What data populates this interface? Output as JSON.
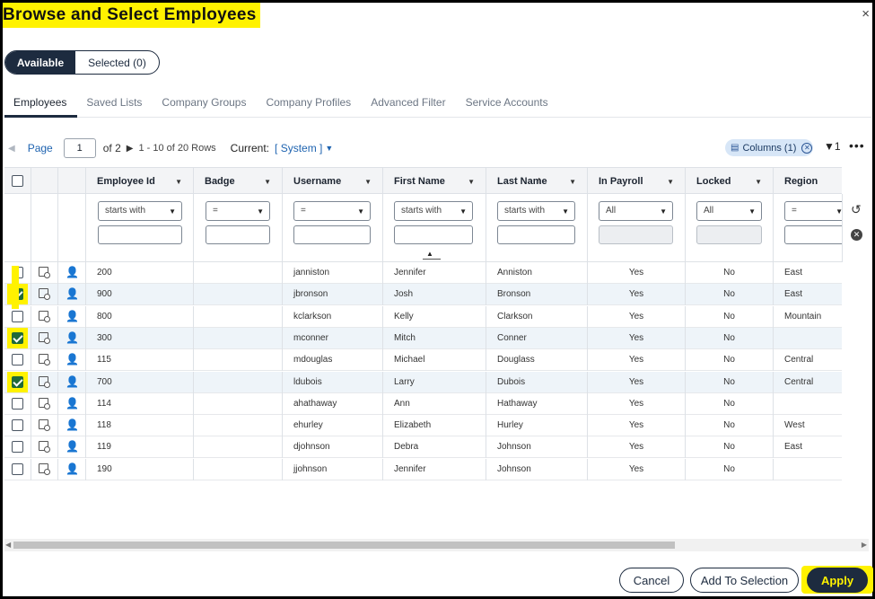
{
  "dialog": {
    "title": "Browse and Select Employees",
    "close_icon": "×"
  },
  "segment": {
    "available": "Available",
    "selected": "Selected (0)"
  },
  "tabs": [
    "Employees",
    "Saved Lists",
    "Company Groups",
    "Company Profiles",
    "Advanced Filter",
    "Service Accounts"
  ],
  "pager": {
    "page_label": "Page",
    "page_value": "1",
    "of_text": "of 2",
    "rows_text": "1 - 10 of 20 Rows",
    "current_label": "Current:",
    "current_value": "[ System ]"
  },
  "toolbar": {
    "columns_label": "Columns (1)",
    "filter_count": "1"
  },
  "columns": [
    "Employee Id",
    "Badge",
    "Username",
    "First Name",
    "Last Name",
    "In Payroll",
    "Locked",
    "Region"
  ],
  "filters": {
    "employee_id": "starts with",
    "badge": "=",
    "username": "=",
    "first_name": "starts with",
    "last_name": "starts with",
    "in_payroll": "All",
    "locked": "All",
    "region": "="
  },
  "rows": [
    {
      "checked": false,
      "id": "200",
      "badge": "",
      "username": "janniston",
      "first": "Jennifer",
      "last": "Anniston",
      "payroll": "Yes",
      "locked": "No",
      "region": "East"
    },
    {
      "checked": true,
      "id": "900",
      "badge": "",
      "username": "jbronson",
      "first": "Josh",
      "last": "Bronson",
      "payroll": "Yes",
      "locked": "No",
      "region": "East"
    },
    {
      "checked": false,
      "id": "800",
      "badge": "",
      "username": "kclarkson",
      "first": "Kelly",
      "last": "Clarkson",
      "payroll": "Yes",
      "locked": "No",
      "region": "Mountain"
    },
    {
      "checked": true,
      "id": "300",
      "badge": "",
      "username": "mconner",
      "first": "Mitch",
      "last": "Conner",
      "payroll": "Yes",
      "locked": "No",
      "region": ""
    },
    {
      "checked": false,
      "id": "115",
      "badge": "",
      "username": "mdouglas",
      "first": "Michael",
      "last": "Douglass",
      "payroll": "Yes",
      "locked": "No",
      "region": "Central"
    },
    {
      "checked": true,
      "id": "700",
      "badge": "",
      "username": "ldubois",
      "first": "Larry",
      "last": "Dubois",
      "payroll": "Yes",
      "locked": "No",
      "region": "Central"
    },
    {
      "checked": false,
      "id": "114",
      "badge": "",
      "username": "ahathaway",
      "first": "Ann",
      "last": "Hathaway",
      "payroll": "Yes",
      "locked": "No",
      "region": ""
    },
    {
      "checked": false,
      "id": "118",
      "badge": "",
      "username": "ehurley",
      "first": "Elizabeth",
      "last": "Hurley",
      "payroll": "Yes",
      "locked": "No",
      "region": "West"
    },
    {
      "checked": false,
      "id": "119",
      "badge": "",
      "username": "djohnson",
      "first": "Debra",
      "last": "Johnson",
      "payroll": "Yes",
      "locked": "No",
      "region": "East"
    },
    {
      "checked": false,
      "id": "190",
      "badge": "",
      "username": "jjohnson",
      "first": "Jennifer",
      "last": "Johnson",
      "payroll": "Yes",
      "locked": "No",
      "region": ""
    }
  ],
  "buttons": {
    "cancel": "Cancel",
    "add": "Add To Selection",
    "apply": "Apply"
  },
  "colors": {
    "highlight": "#fff200",
    "navy": "#1d2b3f",
    "link": "#1e63b0",
    "check": "#1f6a3a"
  }
}
